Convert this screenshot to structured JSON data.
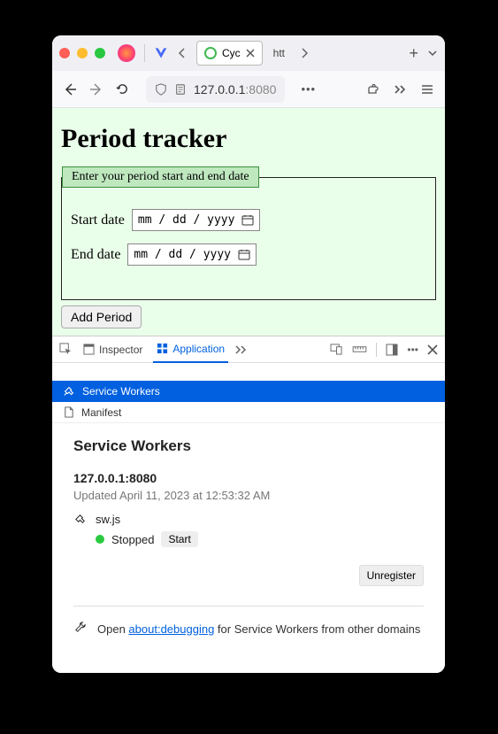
{
  "tabs": {
    "active_label": "Cyc",
    "other_label": "htt"
  },
  "url": {
    "host": "127.0.0.1",
    "port": ":8080"
  },
  "page": {
    "title": "Period tracker",
    "legend": "Enter your period start and end date",
    "start_label": "Start date",
    "end_label": "End date",
    "date_placeholder": "mm / dd / yyyy",
    "add_button": "Add Period"
  },
  "devtools": {
    "inspector_tab": "Inspector",
    "application_tab": "Application",
    "service_workers_row": "Service Workers",
    "manifest_row": "Manifest",
    "sw": {
      "heading": "Service Workers",
      "host": "127.0.0.1:8080",
      "updated": "Updated April 11, 2023 at 12:53:32 AM",
      "file": "sw.js",
      "status": "Stopped",
      "start_btn": "Start",
      "unregister_btn": "Unregister",
      "footer_pre": "Open ",
      "footer_link": "about:debugging",
      "footer_post": " for Service Workers from other domains"
    }
  }
}
